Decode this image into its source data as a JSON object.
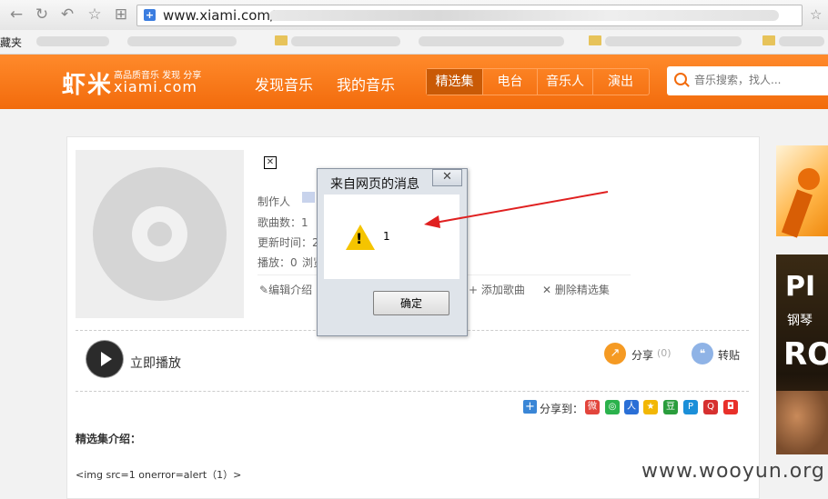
{
  "browser": {
    "url": "www.xiami.com/",
    "bookmarks_label": "藏夹"
  },
  "header": {
    "logo_cn": "虾米",
    "logo_slogan": "高品质音乐 发现 分享",
    "logo_en": "xiami.com",
    "nav": [
      "发现音乐",
      "我的音乐"
    ],
    "tabs": [
      "精选集",
      "电台",
      "音乐人",
      "演出"
    ],
    "active_tab": "精选集",
    "search_placeholder": "音乐搜索，找人..."
  },
  "collection": {
    "meta": {
      "creator_label": "制作人",
      "song_count": "歌曲数：1",
      "updated": "更新时间：2",
      "plays": "播放：0",
      "views": "浏览"
    },
    "actions": [
      "编辑介绍",
      "添加歌曲",
      "删除精选集"
    ],
    "play_label": "立即播放",
    "share_label": "分享",
    "share_count": "(0)",
    "repost_label": "转贴",
    "share_to_label": "分享到：",
    "intro_title": "精选集介绍：",
    "intro_text": "<img src=1 onerror=alert（1）>"
  },
  "dialog": {
    "title": "来自网页的消息",
    "message": "1",
    "ok_label": "确定",
    "close_glyph": "✕"
  },
  "ads": {
    "ad2_line1": "PI",
    "ad2_line2": "钢琴",
    "ad2_line3": "RO"
  },
  "watermark": "www.wooyun.org",
  "colors": {
    "brand_orange": "#f26b0c",
    "active_tab": "#c95a06",
    "arrow_red": "#e02020"
  }
}
